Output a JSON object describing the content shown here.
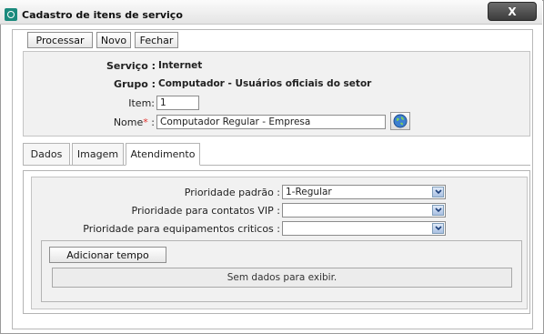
{
  "window": {
    "title": "Cadastro de itens de serviço",
    "close_label": "X"
  },
  "toolbar": {
    "process_label": "Processar",
    "new_label": "Novo",
    "close_label": "Fechar"
  },
  "info": {
    "service_label": "Serviço :",
    "service_value": "Internet",
    "group_label": "Grupo :",
    "group_value": "Computador - Usuários oficiais do setor",
    "item_label": "Item:",
    "item_value": "1",
    "name_label": "Nome",
    "name_required": "*",
    "name_colon": ":",
    "name_value": "Computador Regular - Empresa"
  },
  "tabs": [
    {
      "label": "Dados"
    },
    {
      "label": "Imagem"
    },
    {
      "label": "Atendimento"
    }
  ],
  "attendance": {
    "default_priority_label": "Prioridade padrão :",
    "default_priority_value": "1-Regular",
    "vip_priority_label": "Prioridade para contatos VIP :",
    "vip_priority_value": "",
    "critical_priority_label": "Prioridade para equipamentos criticos :",
    "critical_priority_value": "",
    "add_time_label": "Adicionar tempo",
    "empty_message": "Sem dados para exibir."
  },
  "colors": {
    "accent": "#1b8a7d",
    "required": "#e0302b"
  }
}
